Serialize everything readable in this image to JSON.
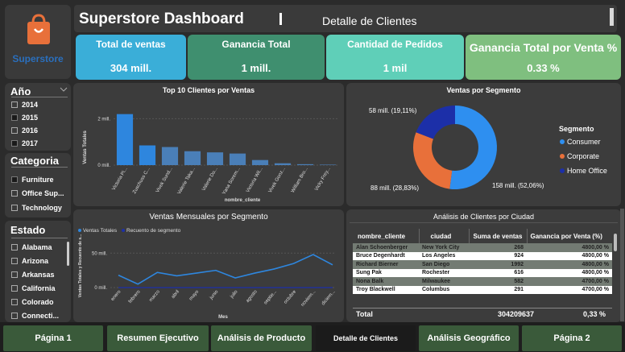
{
  "header": {
    "title": "Superstore Dashboard",
    "subtitle": "Detalle de Clientes",
    "logo_text": "Superstore"
  },
  "kpis": [
    {
      "label": "Total de ventas",
      "value": "304 mill.",
      "color": "#3aaed8"
    },
    {
      "label": "Ganancia Total",
      "value": "1 mill.",
      "color": "#3f8f6f"
    },
    {
      "label": "Cantidad de Pedidos",
      "value": "1 mil",
      "color": "#5fcfb8"
    },
    {
      "label": "Ganancia Total por Venta %",
      "value": "0.33 %",
      "color": "#7fbf7f"
    }
  ],
  "filters": {
    "year": {
      "title": "Año",
      "items": [
        {
          "label": "2014",
          "checked": false
        },
        {
          "label": "2015",
          "checked": true
        },
        {
          "label": "2016",
          "checked": false
        },
        {
          "label": "2017",
          "checked": true
        }
      ]
    },
    "category": {
      "title": "Categoria",
      "items": [
        {
          "label": "Furniture",
          "checked": true
        },
        {
          "label": "Office Sup...",
          "checked": false
        },
        {
          "label": "Technology",
          "checked": false
        }
      ]
    },
    "state": {
      "title": "Estado",
      "items": [
        "Alabama",
        "Arizona",
        "Arkansas",
        "California",
        "Colorado",
        "Connecti..."
      ]
    }
  },
  "chart_data": [
    {
      "type": "bar",
      "title": "Top 10 Clientes por Ventas",
      "xlabel": "nombre_cliente",
      "ylabel": "Ventas Totales",
      "yticks": [
        "2 mill.",
        "0 mill."
      ],
      "ylim": [
        0,
        2.5
      ],
      "categories": [
        "Victoria Pi...",
        "Zuschuss C...",
        "Vivek Sund...",
        "Valerie Taka...",
        "Valerie Do...",
        "Yana Sorem...",
        "Victoria Wil...",
        "Vivek Gonz...",
        "William Bro...",
        "Vicky Frey..."
      ],
      "values": [
        2.2,
        0.85,
        0.78,
        0.6,
        0.55,
        0.5,
        0.22,
        0.08,
        0.04,
        0.02
      ],
      "color": "#2e86de"
    },
    {
      "type": "pie",
      "title": "Ventas por Segmento",
      "legend_title": "Segmento",
      "slices": [
        {
          "name": "Consumer",
          "value": 52.06,
          "label": "158 mill. (52,06%)",
          "color": "#2e8ff0"
        },
        {
          "name": "Corporate",
          "value": 28.83,
          "label": "88 mill. (28,83%)",
          "color": "#e8703a"
        },
        {
          "name": "Home Office",
          "value": 19.11,
          "label": "58 mill. (19,11%)",
          "color": "#1c2fa8"
        }
      ]
    },
    {
      "type": "line",
      "title": "Ventas Mensuales por Segmento",
      "xlabel": "Mes",
      "ylabel": "Ventas Totales y Recuento de s...",
      "yticks": [
        "50 mill.",
        "0 mill."
      ],
      "ylim": [
        0,
        55
      ],
      "categories": [
        "enero",
        "febrero",
        "marzo",
        "abril",
        "mayo",
        "junio",
        "julio",
        "agosto",
        "septie...",
        "octubre",
        "noviem...",
        "diciem..."
      ],
      "series": [
        {
          "name": "Ventas Totales",
          "color": "#2e86de",
          "values": [
            18,
            5,
            22,
            17,
            21,
            25,
            14,
            21,
            27,
            35,
            48,
            33
          ]
        },
        {
          "name": "Recuento de segmento",
          "color": "#1c2fa8",
          "values": [
            0,
            0,
            0,
            0,
            0,
            0,
            0,
            0,
            0,
            0,
            0,
            0
          ]
        }
      ]
    }
  ],
  "table": {
    "title": "Análisis de Clientes por Ciudad",
    "columns": [
      "nombre_cliente",
      "ciudad",
      "Suma de ventas",
      "Ganancia por Venta (%)"
    ],
    "rows": [
      [
        "Alan Schoenberger",
        "New York City",
        "268",
        "4800,00 %"
      ],
      [
        "Bruce Degenhardt",
        "Los Angeles",
        "924",
        "4800,00 %"
      ],
      [
        "Richard Bierner",
        "San Diego",
        "1992",
        "4800,00 %"
      ],
      [
        "Sung Pak",
        "Rochester",
        "616",
        "4800,00 %"
      ],
      [
        "Nona Balk",
        "Milwaukee",
        "582",
        "4700,00 %"
      ],
      [
        "Troy Blackwell",
        "Columbus",
        "291",
        "4700,00 %"
      ]
    ],
    "total": [
      "Total",
      "",
      "304209637",
      "0,33 %"
    ]
  },
  "nav": [
    {
      "label": "Página 1",
      "active": false
    },
    {
      "label": "Resumen Ejecutivo",
      "active": false
    },
    {
      "label": "Análisis de Producto",
      "active": false
    },
    {
      "label": "Detalle de Clientes",
      "active": true
    },
    {
      "label": "Análisis Geográfico",
      "active": false
    },
    {
      "label": "Página 2",
      "active": false
    }
  ]
}
